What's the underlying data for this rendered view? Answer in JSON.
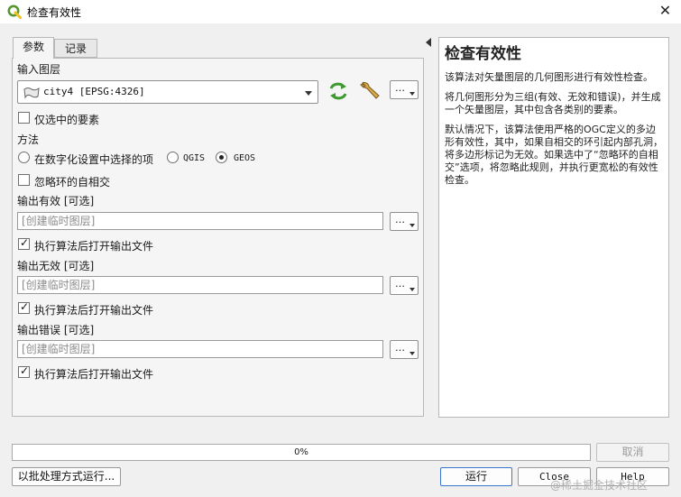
{
  "window": {
    "title": "检查有效性",
    "close_glyph": "✕"
  },
  "tabs": [
    {
      "label": "参数",
      "active": true
    },
    {
      "label": "记录",
      "active": false
    }
  ],
  "params": {
    "input_layer_label": "输入图层",
    "input_layer_value": "city4 [EPSG:4326]",
    "selected_only_label": "仅选中的要素",
    "selected_only_checked": false,
    "method_label": "方法",
    "method_options": [
      {
        "label": "在数字化设置中选择的项",
        "selected": false
      },
      {
        "label": "QGIS",
        "selected": false
      },
      {
        "label": "GEOS",
        "selected": true
      }
    ],
    "ignore_ring_label": "忽略环的自相交",
    "ignore_ring_checked": false,
    "outputs": [
      {
        "label": "输出有效 [可选]",
        "placeholder": "[创建临时图层]",
        "open_label": "执行算法后打开输出文件",
        "open_checked": true
      },
      {
        "label": "输出无效 [可选]",
        "placeholder": "[创建临时图层]",
        "open_label": "执行算法后打开输出文件",
        "open_checked": true
      },
      {
        "label": "输出错误 [可选]",
        "placeholder": "[创建临时图层]",
        "open_label": "执行算法后打开输出文件",
        "open_checked": true
      }
    ],
    "ellipsis": "…"
  },
  "help": {
    "title": "检查有效性",
    "paragraphs": [
      "该算法对矢量图层的几何图形进行有效性检查。",
      "将几何图形分为三组(有效、无效和错误)，并生成一个矢量图层，其中包含各类别的要素。",
      "默认情况下，该算法使用严格的OGC定义的多边形有效性，其中，如果自相交的环引起内部孔洞，将多边形标记为无效。如果选中了“忽略环的自相交”选项，将忽略此规则，并执行更宽松的有效性检查。"
    ]
  },
  "progress": {
    "value": 0,
    "text": "0%"
  },
  "buttons": {
    "cancel": "取消",
    "batch": "以批处理方式运行...",
    "run": "运行",
    "close": "Close",
    "help": "Help"
  },
  "watermark": "@稀土掘金技术社区",
  "colors": {
    "qgis_green": "#589632",
    "accent_blue": "#3a78c9"
  }
}
